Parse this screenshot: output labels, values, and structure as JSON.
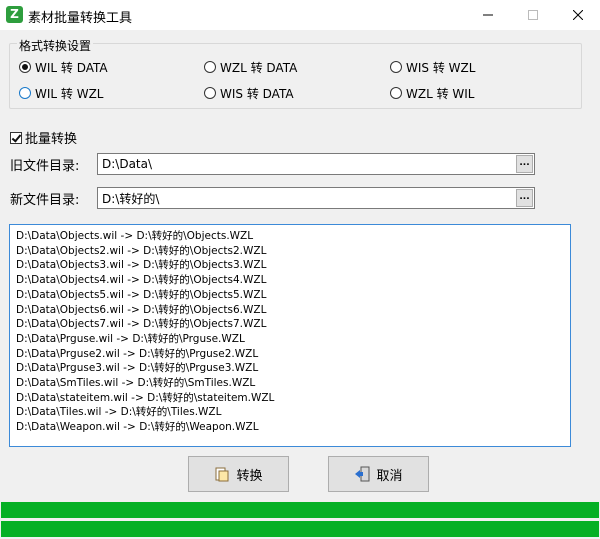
{
  "window": {
    "app_icon_letter": "Z",
    "title": "素材批量转换工具"
  },
  "format_group": {
    "title": "格式转换设置",
    "options": [
      {
        "label": "WIL 转 DATA",
        "checked": true
      },
      {
        "label": "WZL 转 DATA",
        "checked": false
      },
      {
        "label": "WIS 转 WZL",
        "checked": false
      },
      {
        "label": "WIL 转 WZL",
        "checked": false
      },
      {
        "label": "WIS 转 DATA",
        "checked": false
      },
      {
        "label": "WZL 转 WIL",
        "checked": false
      }
    ]
  },
  "batch": {
    "label": "批量转换",
    "checked": true
  },
  "old_dir": {
    "label": "旧文件目录:",
    "value": "D:\\Data\\",
    "browse": "..."
  },
  "new_dir": {
    "label": "新文件目录:",
    "value": "D:\\转好的\\",
    "browse": "..."
  },
  "log": [
    "D:\\Data\\Objects.wil -> D:\\转好的\\Objects.WZL",
    "D:\\Data\\Objects2.wil -> D:\\转好的\\Objects2.WZL",
    "D:\\Data\\Objects3.wil -> D:\\转好的\\Objects3.WZL",
    "D:\\Data\\Objects4.wil -> D:\\转好的\\Objects4.WZL",
    "D:\\Data\\Objects5.wil -> D:\\转好的\\Objects5.WZL",
    "D:\\Data\\Objects6.wil -> D:\\转好的\\Objects6.WZL",
    "D:\\Data\\Objects7.wil -> D:\\转好的\\Objects7.WZL",
    "D:\\Data\\Prguse.wil -> D:\\转好的\\Prguse.WZL",
    "D:\\Data\\Prguse2.wil -> D:\\转好的\\Prguse2.WZL",
    "D:\\Data\\Prguse3.wil -> D:\\转好的\\Prguse3.WZL",
    "D:\\Data\\SmTiles.wil -> D:\\转好的\\SmTiles.WZL",
    "D:\\Data\\stateitem.wil -> D:\\转好的\\stateitem.WZL",
    "D:\\Data\\Tiles.wil -> D:\\转好的\\Tiles.WZL",
    "D:\\Data\\Weapon.wil -> D:\\转好的\\Weapon.WZL"
  ],
  "buttons": {
    "convert": "转换",
    "cancel": "取消"
  },
  "progress": {
    "value_percent": 100,
    "color": "#06b025"
  }
}
